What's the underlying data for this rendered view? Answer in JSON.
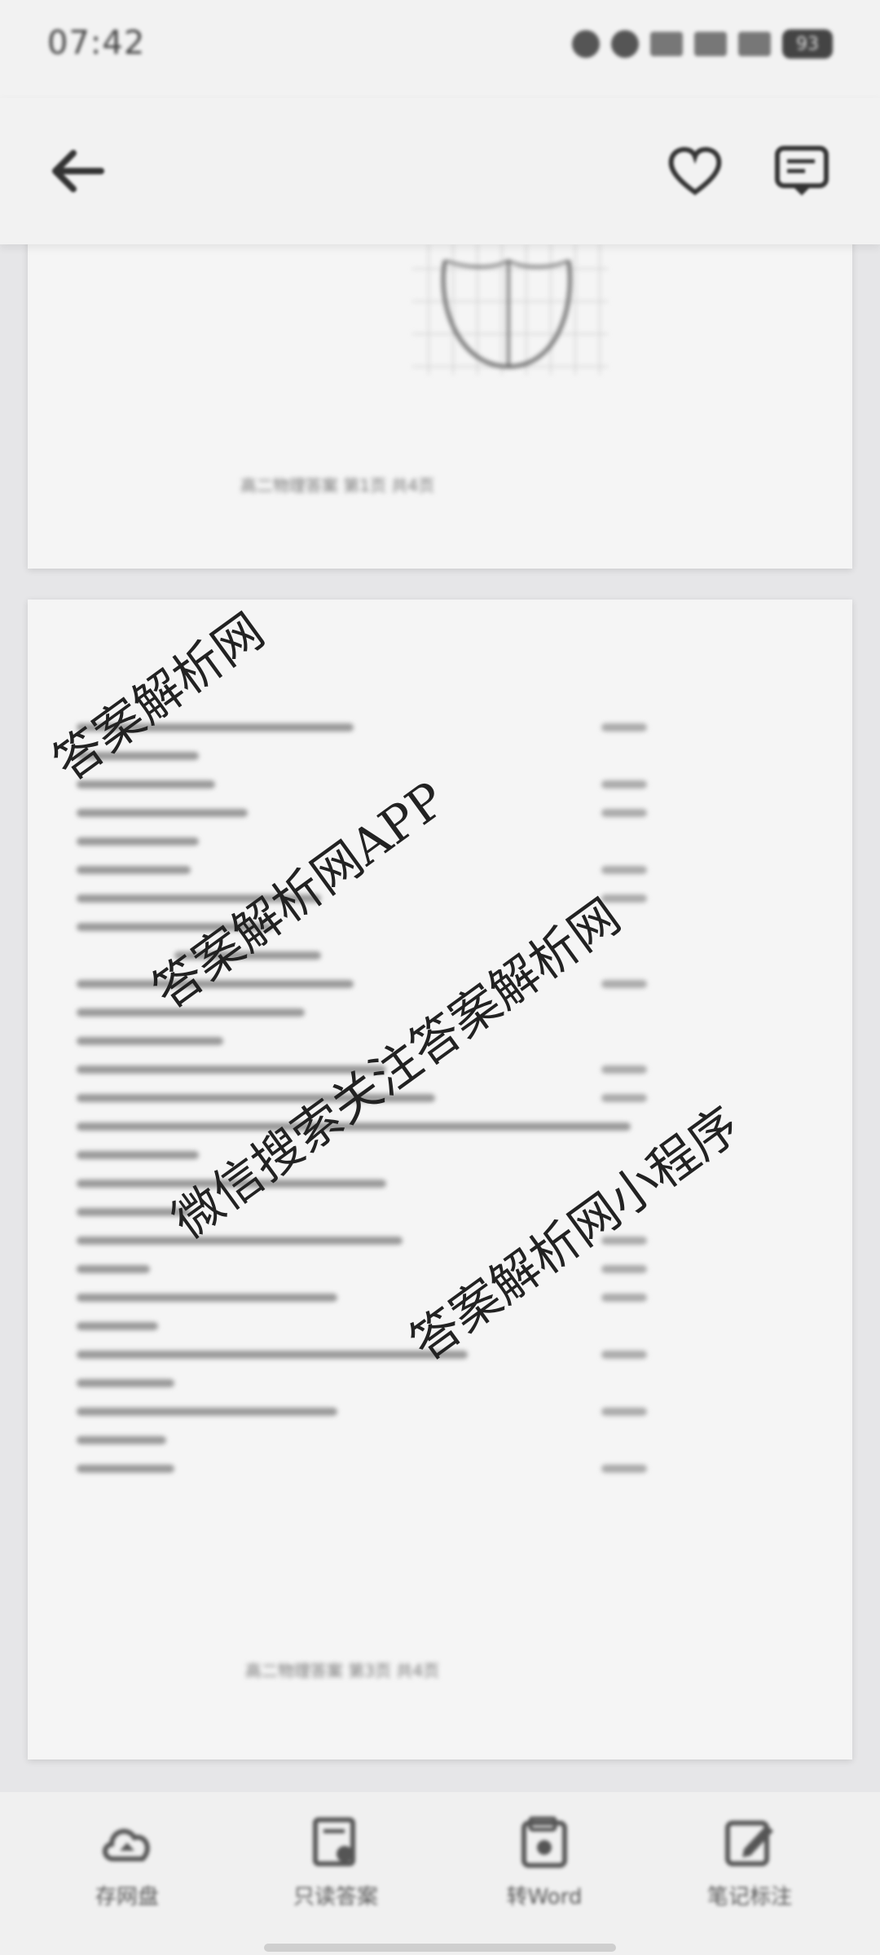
{
  "status_bar": {
    "time": "07:42",
    "battery": "93",
    "icons": [
      "nfc-icon",
      "vibrate-icon",
      "signal-icon",
      "signal-icon",
      "wifi-icon"
    ]
  },
  "top_bar": {
    "back_icon": "arrow-left-icon",
    "favorite_icon": "heart-icon",
    "comment_icon": "comment-icon"
  },
  "document": {
    "pages": [
      {
        "footer": "高二物理答案 第1页 共4页"
      },
      {
        "footer": "高二物理答案 第3页 共4页"
      }
    ]
  },
  "watermarks": [
    "答案解析网",
    "答案解析网APP",
    "微信搜索关注答案解析网",
    "答案解析网小程序"
  ],
  "bottom_nav": {
    "items": [
      {
        "label": "存网盘",
        "icon": "cloud-save-icon"
      },
      {
        "label": "只读答案",
        "icon": "document-icon"
      },
      {
        "label": "转Word",
        "icon": "convert-icon"
      },
      {
        "label": "笔记标注",
        "icon": "edit-note-icon"
      }
    ]
  }
}
